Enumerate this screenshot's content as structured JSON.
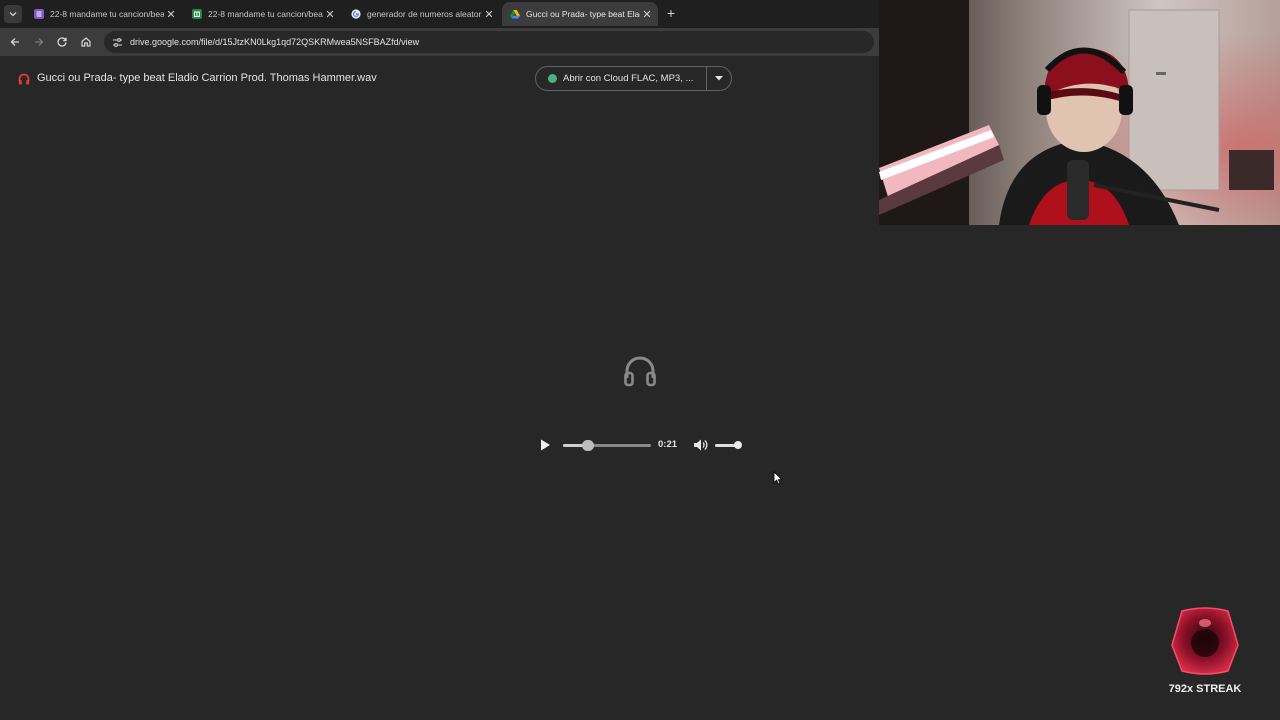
{
  "browser": {
    "tabs": [
      {
        "title": "22-8 mandame tu cancion/beat",
        "icon": "forms-icon",
        "color": "#7e57c2"
      },
      {
        "title": "22-8 mandame tu cancion/beat",
        "icon": "sheets-icon",
        "color": "#1e8e3e"
      },
      {
        "title": "generador de numeros aleatorios",
        "icon": "google-icon",
        "color": "#e8e8e8"
      },
      {
        "title": "Gucci ou Prada- type beat Eladio",
        "icon": "drive-icon",
        "color": "#fbbc04",
        "active": true
      }
    ],
    "url": "drive.google.com/file/d/15JtzKN0Lkg1qd72QSKRMwea5NSFBAZfd/view"
  },
  "drive": {
    "file_title": "Gucci ou Prada- type beat Eladio Carrion Prod. Thomas Hammer.wav",
    "open_with_label": "Abrir con Cloud FLAC, MP3, ..."
  },
  "player": {
    "time": "0:21",
    "progress": 0.28,
    "volume": 0.92
  },
  "overlay": {
    "streak_label": "792x STREAK"
  },
  "colors": {
    "page_bg": "#272727",
    "audio_icon": "#e53935",
    "accent_streak": "#c2183b"
  }
}
